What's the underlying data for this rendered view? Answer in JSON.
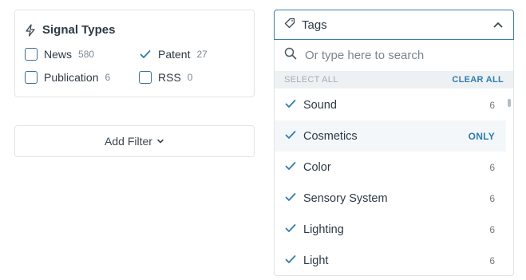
{
  "signal_types": {
    "title": "Signal Types",
    "icon": "bolt-icon",
    "options": [
      {
        "label": "News",
        "count": "580",
        "checked": false
      },
      {
        "label": "Patent",
        "count": "27",
        "checked": true
      },
      {
        "label": "Publication",
        "count": "6",
        "checked": false
      },
      {
        "label": "RSS",
        "count": "0",
        "checked": false
      }
    ]
  },
  "add_filter": {
    "label": "Add Filter",
    "icon": "chevron-down-icon"
  },
  "tags": {
    "header_label": "Tags",
    "icon": "tag-icon",
    "search_placeholder": "Or type here to search",
    "select_all": "SELECT ALL",
    "clear_all": "CLEAR ALL",
    "only_label": "ONLY",
    "items": [
      {
        "name": "Sound",
        "count": "6",
        "checked": true
      },
      {
        "name": "Cosmetics",
        "count": "",
        "checked": true,
        "hovered": true
      },
      {
        "name": "Color",
        "count": "6",
        "checked": true
      },
      {
        "name": "Sensory System",
        "count": "6",
        "checked": true
      },
      {
        "name": "Lighting",
        "count": "6",
        "checked": true
      },
      {
        "name": "Light",
        "count": "6",
        "checked": true
      }
    ]
  },
  "colors": {
    "accent": "#2f7cb0",
    "checkbox_border": "#3b6e93",
    "text": "#2c3a44",
    "muted": "#7c8890"
  }
}
